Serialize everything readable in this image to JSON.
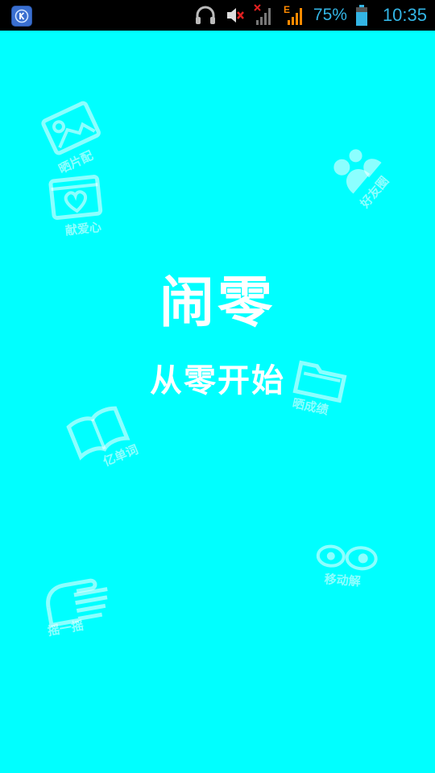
{
  "status_bar": {
    "battery_percent": "75%",
    "time": "10:35",
    "network_type": "E",
    "icons": [
      "app-k-icon",
      "headphones-icon",
      "volume-muted-icon",
      "signal-no-sim-icon",
      "signal-edge-icon",
      "battery-icon"
    ],
    "accent_color": "#33b5e5"
  },
  "splash": {
    "title": "闹零",
    "subtitle": "从零开始",
    "background_color": "#00ffff"
  },
  "doodles": [
    {
      "icon": "photo-icon",
      "label": "晒片配"
    },
    {
      "icon": "heart-card-icon",
      "label": "献爱心"
    },
    {
      "icon": "people-icon",
      "label": "好友圈"
    },
    {
      "icon": "folder-icon",
      "label": "晒成绩"
    },
    {
      "icon": "book-icon",
      "label": "亿单词"
    },
    {
      "icon": "eyes-icon",
      "label": "移动解"
    },
    {
      "icon": "hand-icon",
      "label": "摇一摇"
    }
  ]
}
